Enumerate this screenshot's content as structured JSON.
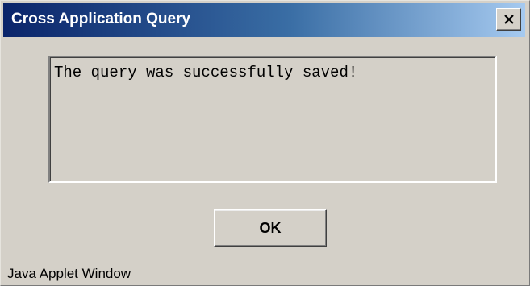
{
  "window": {
    "title": "Cross Application Query",
    "close_icon": "close-x-icon",
    "title_gradient": [
      "#0a246a",
      "#a6caf0"
    ]
  },
  "dialog": {
    "message": "The query was successfully saved!",
    "ok_label": "OK"
  },
  "status_bar": {
    "text": "Java Applet Window"
  }
}
